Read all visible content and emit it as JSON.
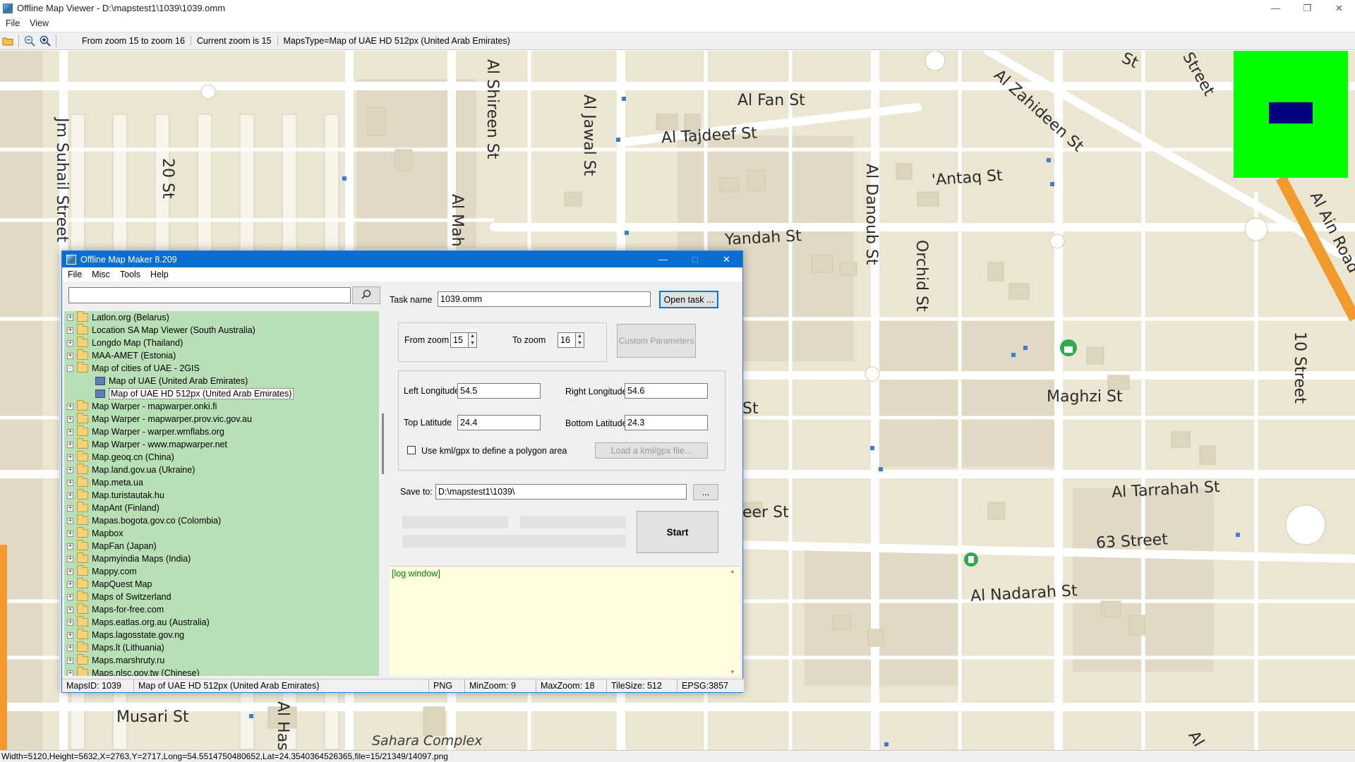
{
  "viewer": {
    "title": "Offline Map Viewer - D:\\mapstest1\\1039\\1039.omm",
    "menu": [
      "File",
      "View"
    ],
    "toolbar": {
      "zoom_range": "From zoom 15 to zoom 16",
      "current_zoom": "Current zoom is 15",
      "maps_type": "MapsType=Map of UAE HD 512px (United Arab Emirates)"
    },
    "status": "Width=5120,Height=5632,X=2763,Y=2717,Long=54.5514750480652,Lat=24.3540364526365,file=15/21349/14097.png"
  },
  "map": {
    "labels": [
      "Jm Suhail Street",
      "20 St",
      "Al Shireen St",
      "Al Jawal St",
      "Al Mah",
      "Al Fan St",
      "Al Tajdeef St",
      "Al Zahideen St",
      "'Antaq St",
      "Al Danoub St",
      "Yandah St",
      "Orchid St",
      "Al Ain Road",
      "10 Street",
      "Maghzi St",
      "St",
      "Al Tarrahah St",
      "eer St",
      "63 Street",
      "Al Nadarah St",
      "Musari St",
      "Al Has",
      "Sahara Complex",
      "Al",
      "Street",
      "St"
    ],
    "minimap_color": "#00ff00",
    "minimap_viewport_color": "#000080"
  },
  "dialog": {
    "title": "Offline Map Maker 8.209",
    "menu": [
      "File",
      "Misc",
      "Tools",
      "Help"
    ],
    "search": {
      "value": ""
    },
    "tree": [
      {
        "label": "Latlon.org (Belarus)",
        "expander": "+"
      },
      {
        "label": "Location SA Map Viewer (South Australia)",
        "expander": "+"
      },
      {
        "label": "Longdo Map (Thailand)",
        "expander": "+"
      },
      {
        "label": "MAA-AMET (Estonia)",
        "expander": "+"
      },
      {
        "label": "Map of cities of UAE - 2GIS",
        "expander": "-"
      },
      {
        "label": "Map of UAE (United Arab Emirates)",
        "child": true
      },
      {
        "label": "Map of UAE HD 512px (United Arab Emirates)",
        "child": true,
        "selected": true
      },
      {
        "label": "Map Warper - mapwarper.onki.fi",
        "expander": "+"
      },
      {
        "label": "Map Warper - mapwarper.prov.vic.gov.au",
        "expander": "+"
      },
      {
        "label": "Map Warper - warper.wmflabs.org",
        "expander": "+"
      },
      {
        "label": "Map Warper - www.mapwarper.net",
        "expander": "+"
      },
      {
        "label": "Map.geoq.cn (China)",
        "expander": "+"
      },
      {
        "label": "Map.land.gov.ua (Ukraine)",
        "expander": "+"
      },
      {
        "label": "Map.meta.ua",
        "expander": "+"
      },
      {
        "label": "Map.turistautak.hu",
        "expander": "+"
      },
      {
        "label": "MapAnt (Finland)",
        "expander": "+"
      },
      {
        "label": "Mapas.bogota.gov.co (Colombia)",
        "expander": "+"
      },
      {
        "label": "Mapbox",
        "expander": "+"
      },
      {
        "label": "MapFan (Japan)",
        "expander": "+"
      },
      {
        "label": "Mapmyindia Maps (India)",
        "expander": "+"
      },
      {
        "label": "Mappy.com",
        "expander": "+"
      },
      {
        "label": "MapQuest Map",
        "expander": "+"
      },
      {
        "label": "Maps of Switzerland",
        "expander": "+"
      },
      {
        "label": "Maps-for-free.com",
        "expander": "+"
      },
      {
        "label": "Maps.eatlas.org.au (Australia)",
        "expander": "+"
      },
      {
        "label": "Maps.lagosstate.gov.ng",
        "expander": "+"
      },
      {
        "label": "Maps.lt (Lithuania)",
        "expander": "+"
      },
      {
        "label": "Maps.marshruty.ru",
        "expander": "+"
      },
      {
        "label": "Maps.nlsc.gov.tw (Chinese)",
        "expander": "+"
      }
    ],
    "form": {
      "task_name_label": "Task name",
      "task_name_value": "1039.omm",
      "open_task_label": "Open task ...",
      "from_zoom_label": "From zoom",
      "from_zoom_value": "15",
      "to_zoom_label": "To zoom",
      "to_zoom_value": "16",
      "custom_params_label": "Custom Parameters",
      "left_lon_label": "Left Longitude",
      "left_lon_value": "54.5",
      "right_lon_label": "Right Longitude",
      "right_lon_value": "54.6",
      "top_lat_label": "Top Latitude",
      "top_lat_value": "24.4",
      "bottom_lat_label": "Bottom Latitude",
      "bottom_lat_value": "24.3",
      "use_kml_label": "Use kml/gpx to define a polygon area",
      "load_kml_label": "Load a kml/gpx file...",
      "save_to_label": "Save to:",
      "save_to_value": "D:\\mapstest1\\1039\\",
      "browse_label": "...",
      "start_label": "Start"
    },
    "log_text": "[log window]",
    "status": {
      "maps_id": "MapsID: 1039",
      "map_name": "Map of UAE HD 512px (United Arab Emirates)",
      "format": "PNG",
      "min_zoom": "MinZoom: 9",
      "max_zoom": "MaxZoom: 18",
      "tile_size": "TileSize: 512",
      "epsg": "EPSG:3857"
    }
  }
}
